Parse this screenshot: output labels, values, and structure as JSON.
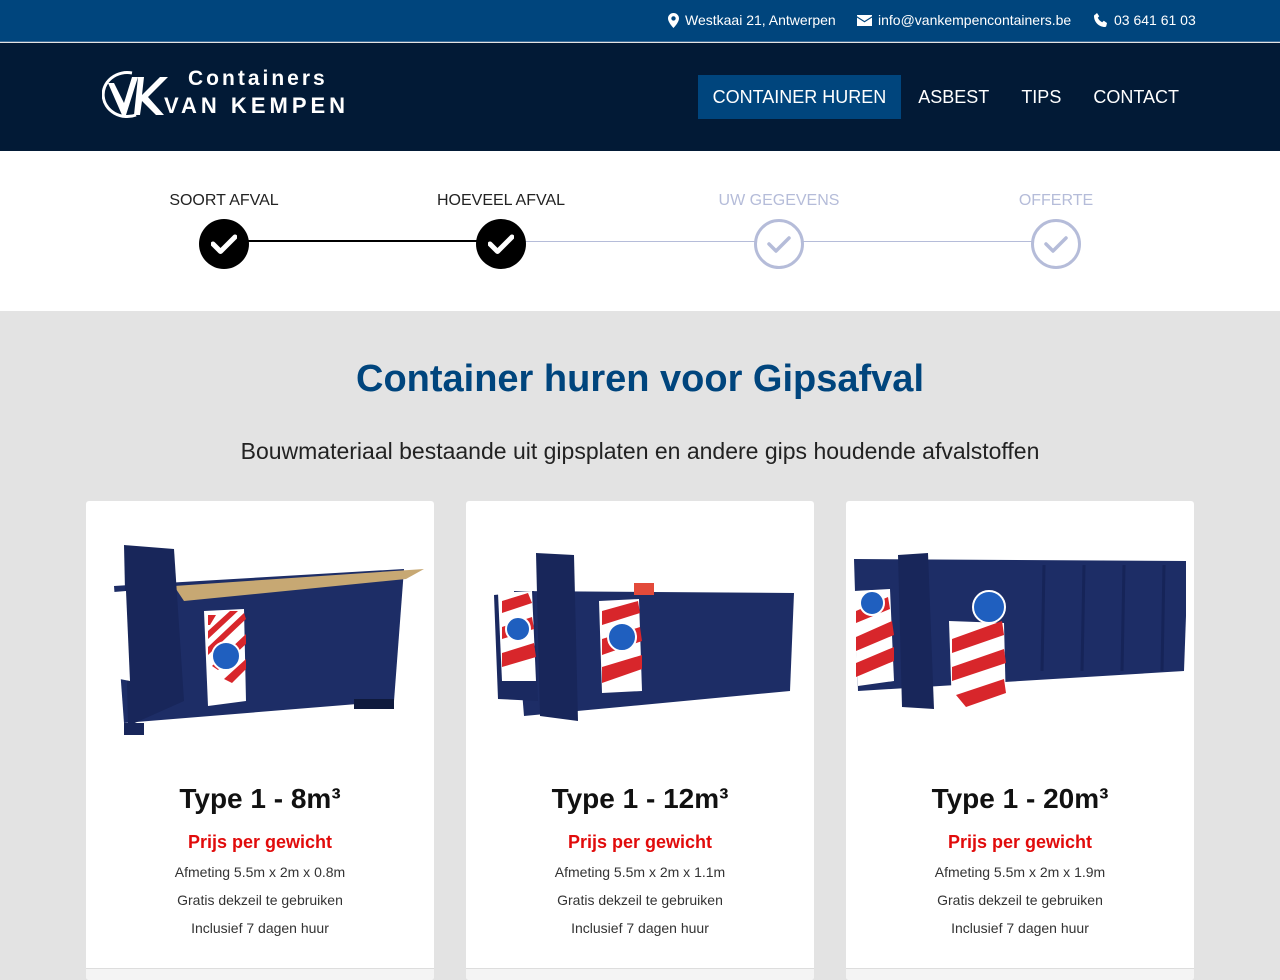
{
  "topbar": {
    "address": "Westkaai 21, Antwerpen",
    "email": "info@vankempencontainers.be",
    "phone": "03 641 61 03",
    "icons": [
      "location-pin-icon",
      "envelope-icon",
      "phone-icon"
    ]
  },
  "logo": {
    "mark": "VK",
    "line1": "Containers",
    "line2": "VAN KEMPEN"
  },
  "nav": {
    "items": [
      {
        "label": "CONTAINER HUREN",
        "active": true
      },
      {
        "label": "ASBEST",
        "active": false
      },
      {
        "label": "TIPS",
        "active": false
      },
      {
        "label": "CONTACT",
        "active": false
      }
    ]
  },
  "steps": [
    {
      "label": "SOORT AFVAL",
      "done": true
    },
    {
      "label": "HOEVEEL AFVAL",
      "done": true
    },
    {
      "label": "UW GEGEVENS",
      "done": false
    },
    {
      "label": "OFFERTE",
      "done": false
    }
  ],
  "main": {
    "title": "Container huren voor Gipsafval",
    "subtitle": "Bouwmateriaal bestaande uit gipsplaten en andere gips houdende afvalstoffen"
  },
  "cards": [
    {
      "title": "Type 1 - 8m³",
      "price": "Prijs per gewicht",
      "features": [
        "Afmeting 5.5m x 2m x 0.8m",
        "Gratis dekzeil te gebruiken",
        "Inclusief 7 dagen huur"
      ]
    },
    {
      "title": "Type 1 - 12m³",
      "price": "Prijs per gewicht",
      "features": [
        "Afmeting 5.5m x 2m x 1.1m",
        "Gratis dekzeil te gebruiken",
        "Inclusief 7 dagen huur"
      ]
    },
    {
      "title": "Type 1 - 20m³",
      "price": "Prijs per gewicht",
      "features": [
        "Afmeting 5.5m x 2m x 1.9m",
        "Gratis dekzeil te gebruiken",
        "Inclusief 7 dagen huur"
      ]
    }
  ],
  "colors": {
    "brand_blue": "#00457d",
    "header_navy": "#021a36",
    "container_blue": "#1d2d66",
    "price_red": "#e10b0b",
    "step_pending": "#b5bcd9"
  }
}
